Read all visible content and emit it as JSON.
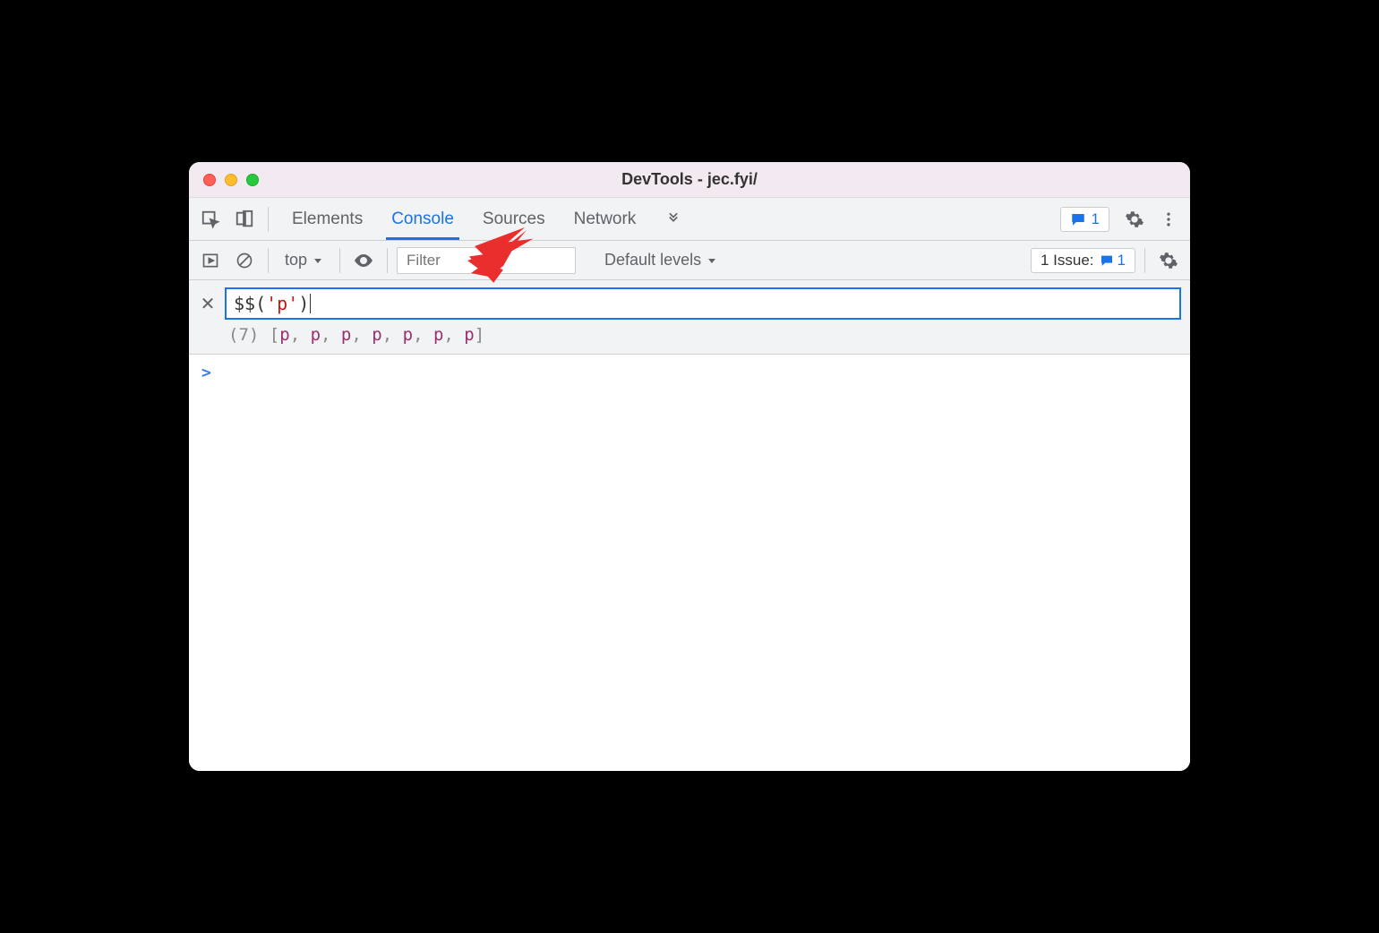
{
  "window": {
    "title": "DevTools - jec.fyi/"
  },
  "tabs": {
    "elements": "Elements",
    "console": "Console",
    "sources": "Sources",
    "network": "Network"
  },
  "messages_count": "1",
  "console_toolbar": {
    "context": "top",
    "filter_placeholder": "Filter",
    "log_levels": "Default levels",
    "issues_label": "1 Issue:",
    "issues_count": "1"
  },
  "expression": {
    "func": "$$",
    "open": "(",
    "string": "'p'",
    "close": ")"
  },
  "result": {
    "count": "(7)",
    "elements": [
      "p",
      "p",
      "p",
      "p",
      "p",
      "p",
      "p"
    ]
  },
  "prompt": ">"
}
